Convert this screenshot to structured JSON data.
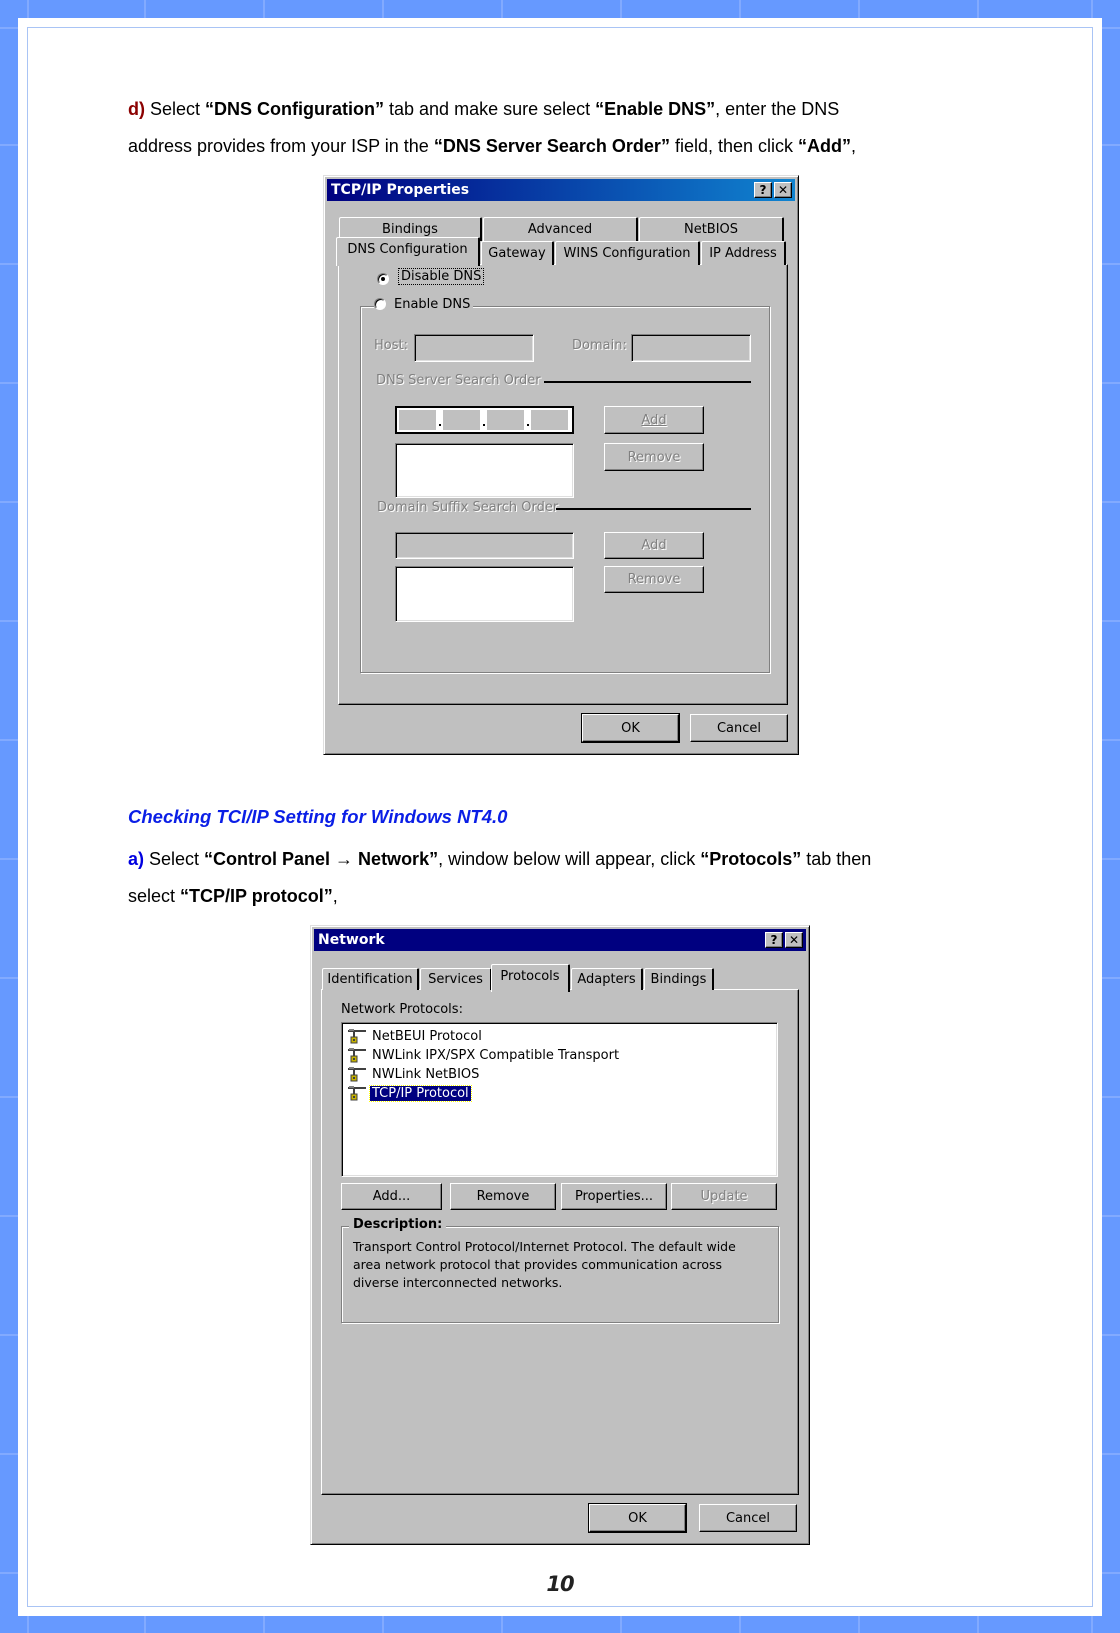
{
  "document": {
    "step_d": {
      "marker": "d)",
      "line1_parts": [
        {
          "text": " Select ",
          "bold": false
        },
        {
          "text": "“DNS Configuration”",
          "bold": true
        },
        {
          "text": " tab and make sure select ",
          "bold": false
        },
        {
          "text": "“Enable DNS”",
          "bold": true
        },
        {
          "text": ", enter the DNS",
          "bold": false
        }
      ],
      "line2_parts": [
        {
          "text": "address provides from your ISP in the ",
          "bold": false
        },
        {
          "text": "“DNS Server Search Order”",
          "bold": true
        },
        {
          "text": " field, then click ",
          "bold": false
        },
        {
          "text": "“Add”",
          "bold": true
        },
        {
          "text": ",",
          "bold": false
        }
      ]
    },
    "section_heading": "Checking TCI/IP Setting for Windows NT4.0",
    "step_a": {
      "marker": "a)",
      "line1_parts": [
        {
          "text": " Select ",
          "bold": false
        },
        {
          "text": "“Control Panel → Network”",
          "bold": true
        },
        {
          "text": ", window below will appear, click ",
          "bold": false
        },
        {
          "text": "“Protocols”",
          "bold": true
        },
        {
          "text": " tab then",
          "bold": false
        }
      ],
      "line2_parts": [
        {
          "text": "select ",
          "bold": false
        },
        {
          "text": "“TCP/IP protocol”",
          "bold": true
        },
        {
          "text": ",",
          "bold": false
        }
      ]
    },
    "page_number": "10",
    "colors": {
      "frame_blue": "#6699ff",
      "step_d_marker": "#8b0000",
      "step_a_marker": "#0000e0",
      "heading": "#0a1ee6",
      "win_face": "#c0c0c0",
      "title_active": "#000080",
      "selection": "#000080"
    }
  },
  "tcpip_dialog": {
    "title": "TCP/IP Properties",
    "help_btn": "?",
    "close_btn": "✕",
    "tabs_back": [
      "Bindings",
      "Advanced",
      "NetBIOS"
    ],
    "tabs_front": [
      "DNS Configuration",
      "Gateway",
      "WINS Configuration",
      "IP Address"
    ],
    "active_tab": "DNS Configuration",
    "radio_disable": {
      "label": "Disable DNS",
      "selected": true
    },
    "radio_enable": {
      "label": "Enable DNS",
      "selected": false
    },
    "host_label": "Host:",
    "host_value": "",
    "domain_label": "Domain:",
    "domain_value": "",
    "dns_server_group": "DNS Server Search Order",
    "dns_ip_value": [
      "",
      "",
      "",
      ""
    ],
    "dns_add": "Add",
    "dns_remove": "Remove",
    "suffix_group": "Domain Suffix Search Order",
    "suffix_value": "",
    "suffix_add": "Add",
    "suffix_remove": "Remove",
    "ok": "OK",
    "cancel": "Cancel"
  },
  "network_dialog": {
    "title": "Network",
    "help_btn": "?",
    "close_btn": "✕",
    "tabs": [
      "Identification",
      "Services",
      "Protocols",
      "Adapters",
      "Bindings"
    ],
    "active_tab": "Protocols",
    "list_label": "Network Protocols:",
    "protocols": [
      {
        "name": "NetBEUI Protocol",
        "selected": false
      },
      {
        "name": "NWLink IPX/SPX Compatible Transport",
        "selected": false
      },
      {
        "name": "NWLink NetBIOS",
        "selected": false
      },
      {
        "name": "TCP/IP Protocol",
        "selected": true
      }
    ],
    "btn_add": "Add...",
    "btn_remove": "Remove",
    "btn_properties": "Properties...",
    "btn_update": "Update",
    "description_label": "Description:",
    "description_lines": [
      "Transport Control Protocol/Internet Protocol. The default wide",
      "area network protocol that provides communication across",
      "diverse interconnected networks."
    ],
    "ok": "OK",
    "cancel": "Cancel"
  }
}
